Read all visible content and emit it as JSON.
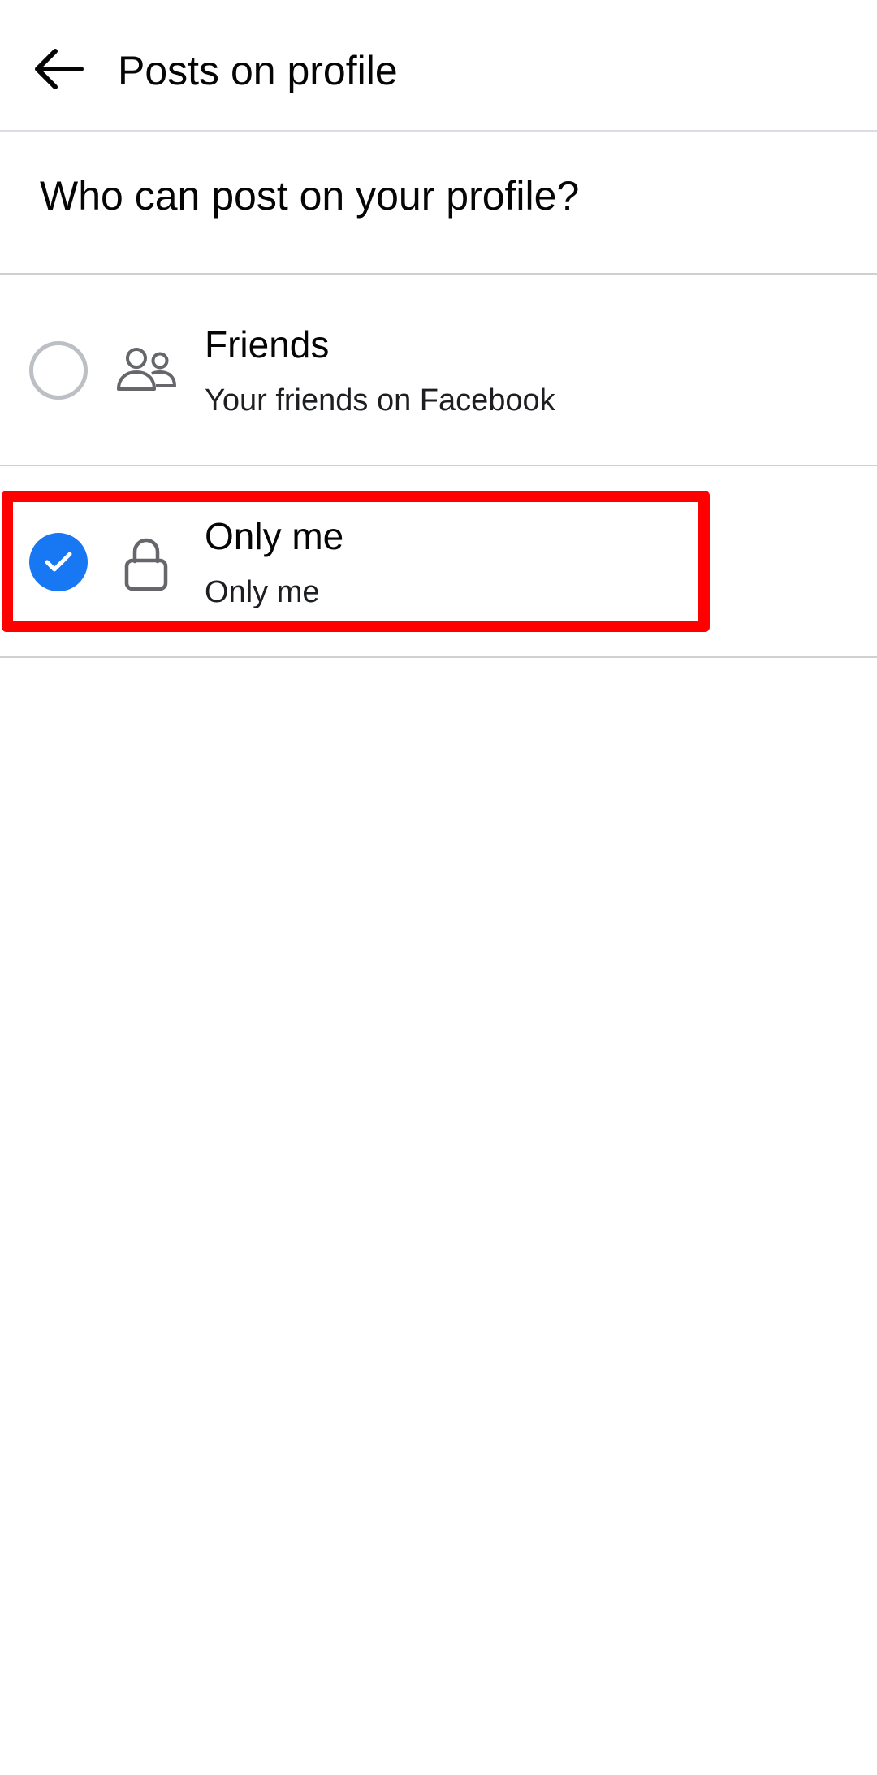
{
  "header": {
    "title": "Posts on profile",
    "back_icon": "arrow-left-icon"
  },
  "question": {
    "text": "Who can post on your profile?"
  },
  "options": [
    {
      "title": "Friends",
      "subtitle": "Your friends on Facebook",
      "icon": "friends-icon",
      "selected": false
    },
    {
      "title": "Only me",
      "subtitle": "Only me",
      "icon": "lock-icon",
      "selected": true
    }
  ],
  "colors": {
    "accent": "#1877f2",
    "highlight": "#ff0000",
    "divider": "#ced0d4"
  }
}
